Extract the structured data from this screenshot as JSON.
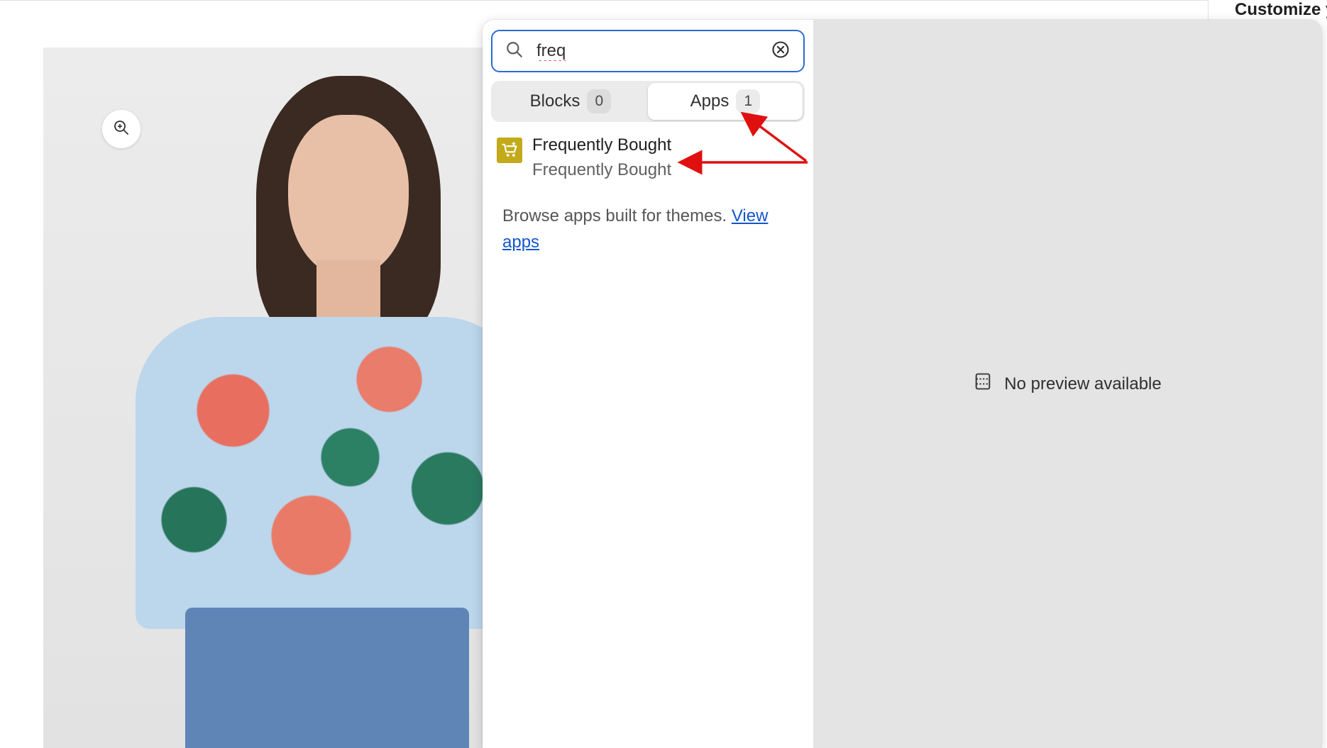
{
  "canvas": {
    "zoom_button_icon": "zoom-in-icon"
  },
  "popover": {
    "search": {
      "value": "freq",
      "search_icon": "search-icon",
      "clear_icon": "clear-circle-icon"
    },
    "tabs": [
      {
        "label": "Blocks",
        "count": "0",
        "active": false
      },
      {
        "label": "Apps",
        "count": "1",
        "active": true
      }
    ],
    "results": [
      {
        "title": "Frequently Bought",
        "subtitle": "Frequently Bought",
        "icon": "cart-icon"
      }
    ],
    "browse": {
      "text": "Browse apps built for themes.",
      "link": "View apps"
    },
    "preview": {
      "message": "No preview available",
      "icon": "no-preview-icon"
    }
  },
  "sidebar": {
    "title": "Customize y"
  },
  "annotations": {
    "arrow_color": "#e01010"
  },
  "colors": {
    "focus_border": "#2a6bd4",
    "link": "#1356cc",
    "app_icon_bg": "#c2aa18",
    "preview_bg": "#e4e4e4"
  }
}
